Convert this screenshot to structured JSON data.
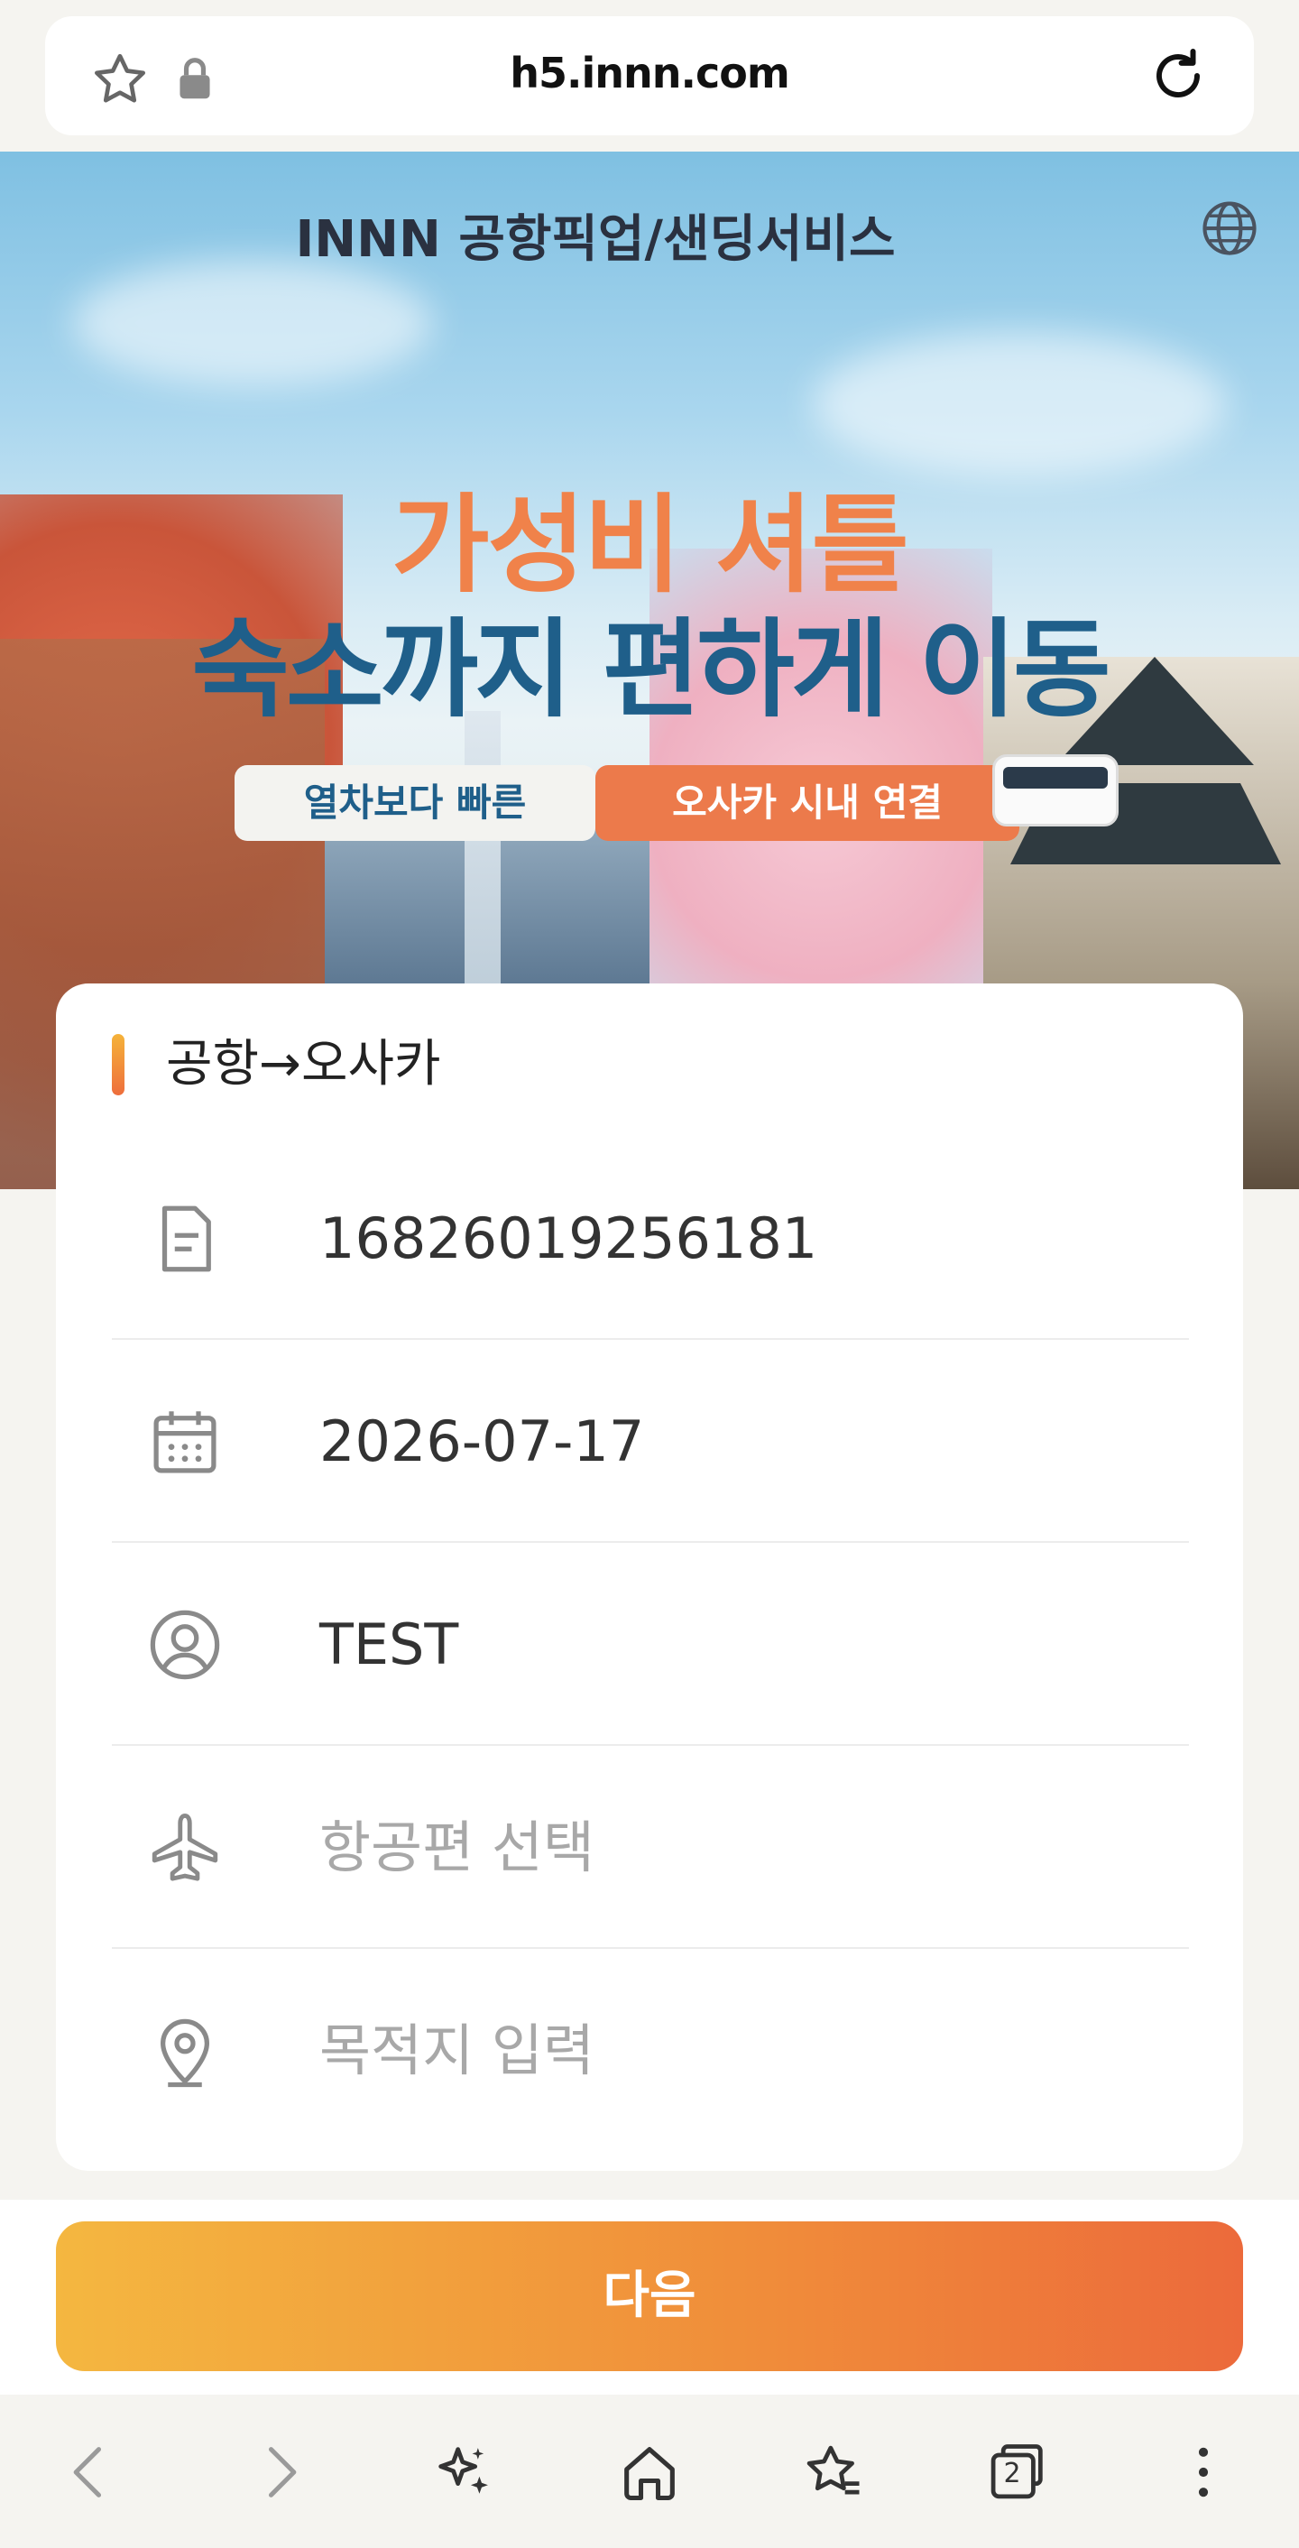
{
  "browser": {
    "url": "h5.innn.com",
    "tab_count": "2"
  },
  "banner": {
    "title": "INNN 공항픽업/샌딩서비스",
    "headline_1": "가성비 셔틀",
    "headline_2": "숙소까지 편하게 이동",
    "tag_left": "열차보다 빠른",
    "tag_right": "오사카 시내 연결"
  },
  "form": {
    "route": "공항→오사카",
    "order_number": "16826019256181",
    "date": "2026-07-17",
    "name": "TEST",
    "flight_placeholder": "항공편 선택",
    "destination_placeholder": "목적지 입력"
  },
  "cta": {
    "next_label": "다음"
  },
  "colors": {
    "accent_start": "#f4b740",
    "accent_end": "#ec6a3b",
    "headline_orange": "#f0824a",
    "headline_blue": "#1f5f8a"
  }
}
